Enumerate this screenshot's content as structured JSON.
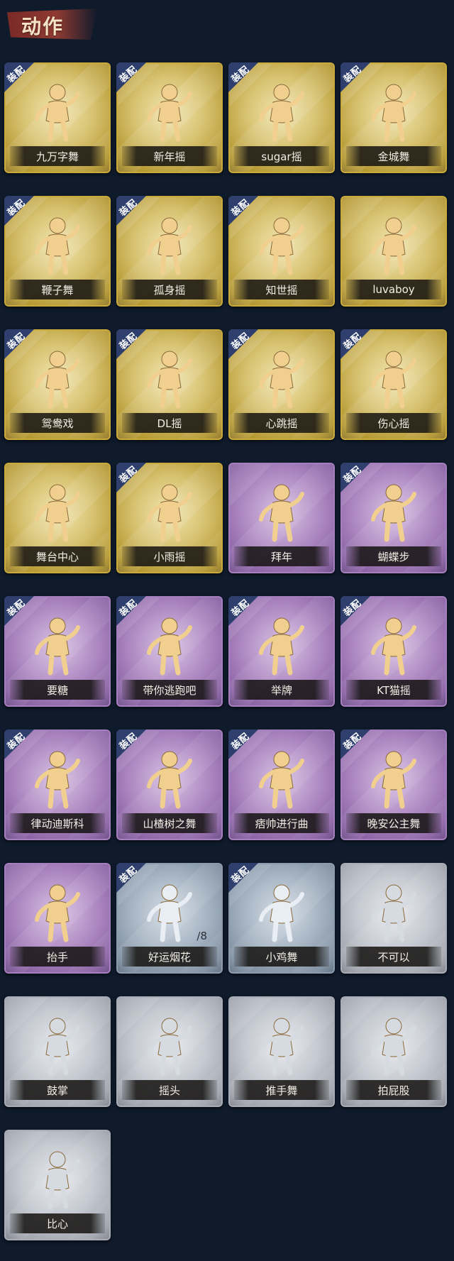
{
  "header": {
    "title": "动作"
  },
  "equip_badge": "装配",
  "cards": [
    {
      "label": "九万字舞",
      "tier": "gold",
      "equipped": true
    },
    {
      "label": "新年摇",
      "tier": "gold",
      "equipped": true
    },
    {
      "label": "sugar摇",
      "tier": "gold",
      "equipped": true
    },
    {
      "label": "金城舞",
      "tier": "gold",
      "equipped": true
    },
    {
      "label": "鞭子舞",
      "tier": "gold",
      "equipped": true
    },
    {
      "label": "孤身摇",
      "tier": "gold",
      "equipped": true
    },
    {
      "label": "知世摇",
      "tier": "gold",
      "equipped": true
    },
    {
      "label": "luvaboy",
      "tier": "gold",
      "equipped": false
    },
    {
      "label": "鸳鸯戏",
      "tier": "gold",
      "equipped": true
    },
    {
      "label": "DL摇",
      "tier": "gold",
      "equipped": true
    },
    {
      "label": "心跳摇",
      "tier": "gold",
      "equipped": true
    },
    {
      "label": "伤心摇",
      "tier": "gold",
      "equipped": true
    },
    {
      "label": "舞台中心",
      "tier": "gold",
      "equipped": false
    },
    {
      "label": "小雨摇",
      "tier": "gold",
      "equipped": true
    },
    {
      "label": "拜年",
      "tier": "purple",
      "equipped": false
    },
    {
      "label": "蝴蝶步",
      "tier": "purple",
      "equipped": true
    },
    {
      "label": "要糖",
      "tier": "purple",
      "equipped": true
    },
    {
      "label": "带你逃跑吧",
      "tier": "purple",
      "equipped": true
    },
    {
      "label": "举牌",
      "tier": "purple",
      "equipped": true
    },
    {
      "label": "KT猫摇",
      "tier": "purple",
      "equipped": true
    },
    {
      "label": "律动迪斯科",
      "tier": "purple",
      "equipped": true
    },
    {
      "label": "山楂树之舞",
      "tier": "purple",
      "equipped": true
    },
    {
      "label": "痞帅进行曲",
      "tier": "purple",
      "equipped": true
    },
    {
      "label": "晚安公主舞",
      "tier": "purple",
      "equipped": true
    },
    {
      "label": "抬手",
      "tier": "purple",
      "equipped": false
    },
    {
      "label": "好运烟花",
      "tier": "blue",
      "equipped": true,
      "count": "/8"
    },
    {
      "label": "小鸡舞",
      "tier": "blue",
      "equipped": true
    },
    {
      "label": "不可以",
      "tier": "gray",
      "equipped": false
    },
    {
      "label": "鼓掌",
      "tier": "gray",
      "equipped": false
    },
    {
      "label": "摇头",
      "tier": "gray",
      "equipped": false
    },
    {
      "label": "推手舞",
      "tier": "gray",
      "equipped": false
    },
    {
      "label": "拍屁股",
      "tier": "gray",
      "equipped": false
    },
    {
      "label": "比心",
      "tier": "gray",
      "equipped": false
    }
  ],
  "colors": {
    "background": "#0f1a2b",
    "gold": "#c9ab3c",
    "purple": "#a67fbf",
    "blue": "#8c9cae",
    "gray": "#a8adb6",
    "badge": "#2e3f6e"
  }
}
